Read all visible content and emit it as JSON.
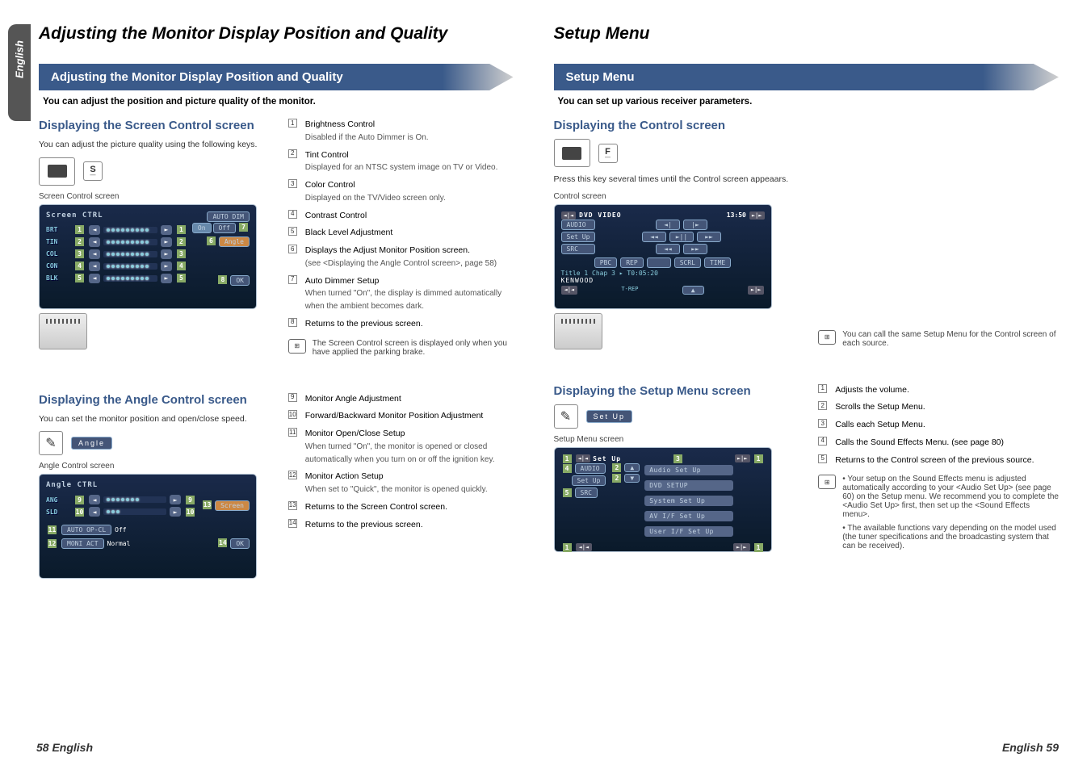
{
  "left": {
    "main_title": "Adjusting the Monitor Display Position and Quality",
    "side_tab": "English",
    "banner": "Adjusting the Monitor Display Position and Quality",
    "subtitle": "You can adjust the position and picture quality of the monitor.",
    "section1": {
      "heading": "Displaying the Screen Control screen",
      "body": "You can adjust the picture quality using the following keys.",
      "key_letter": "S",
      "screenshot_label": "Screen Control screen",
      "screen_title": "Screen CTRL",
      "auto_dim_label": "AUTO DIM",
      "on_label": "On",
      "off_label": "Off",
      "angle_btn": "Angle",
      "ok_btn": "OK",
      "sliders": [
        "BRT",
        "TIN",
        "COL",
        "CON",
        "BLK"
      ],
      "items": [
        {
          "n": "1",
          "title": "Brightness Control",
          "sub": "Disabled if the Auto Dimmer is On."
        },
        {
          "n": "2",
          "title": "Tint Control",
          "sub": "Displayed for an NTSC system image on TV or Video."
        },
        {
          "n": "3",
          "title": "Color Control",
          "sub": "Displayed on the TV/Video screen only."
        },
        {
          "n": "4",
          "title": "Contrast Control",
          "sub": ""
        },
        {
          "n": "5",
          "title": "Black Level Adjustment",
          "sub": ""
        },
        {
          "n": "6",
          "title": "Displays the Adjust Monitor Position screen.",
          "sub": "(see <Displaying the Angle Control screen>, page 58)"
        },
        {
          "n": "7",
          "title": "Auto Dimmer Setup",
          "sub": "When turned \"On\", the display is dimmed automatically when the ambient becomes dark."
        },
        {
          "n": "8",
          "title": "Returns to the previous screen.",
          "sub": ""
        }
      ],
      "note": "The Screen Control screen is displayed only when you have applied the parking brake."
    },
    "section2": {
      "heading": "Displaying the Angle Control screen",
      "body": "You can set the monitor position and open/close speed.",
      "angle_btn_label": "Angle",
      "screenshot_label": "Angle Control screen",
      "screen_title": "Angle CTRL",
      "ang_label": "ANG",
      "sld_label": "SLD",
      "auto_opcl_label": "AUTO OP-CL",
      "auto_opcl_value": "Off",
      "moni_act_label": "MONI ACT",
      "moni_act_value": "Normal",
      "screen_btn": "Screen",
      "ok_btn": "OK",
      "items": [
        {
          "n": "9",
          "title": "Monitor Angle Adjustment",
          "sub": ""
        },
        {
          "n": "10",
          "title": "Forward/Backward Monitor Position Adjustment",
          "sub": ""
        },
        {
          "n": "11",
          "title": "Monitor Open/Close Setup",
          "sub": "When turned \"On\", the monitor is opened or closed automatically when you turn on or off the ignition key."
        },
        {
          "n": "12",
          "title": "Monitor Action Setup",
          "sub": "When set to \"Quick\", the monitor is opened quickly."
        },
        {
          "n": "13",
          "title": "Returns to the Screen Control screen.",
          "sub": ""
        },
        {
          "n": "14",
          "title": "Returns to the previous screen.",
          "sub": ""
        }
      ]
    },
    "footer": "58 English"
  },
  "right": {
    "main_title": "Setup Menu",
    "banner": "Setup Menu",
    "subtitle": "You can set up various receiver parameters.",
    "section1": {
      "heading": "Displaying the Control screen",
      "key_letter": "F",
      "body": "Press this key several times until the Control screen appeaars.",
      "screenshot_label": "Control screen",
      "screen": {
        "title": "DVD VIDEO",
        "time": "13:50",
        "btns": [
          "AUDIO",
          "Set Up",
          "SRC"
        ],
        "lower_btns": [
          "PBC",
          "REP",
          "SCRL",
          "TIME"
        ],
        "status": "Title 1   Chap   3   ▸   T0:05:20",
        "brand": "KENWOOD",
        "trep": "T-REP"
      },
      "note": "You can call the same Setup Menu for the Control screen of each source."
    },
    "section2": {
      "heading": "Displaying the Setup Menu screen",
      "setup_btn": "Set Up",
      "screenshot_label": "Setup Menu screen",
      "screen": {
        "title": "Set Up",
        "side_btns": [
          "AUDIO",
          "Set Up",
          "SRC"
        ],
        "menu": [
          "Audio Set Up",
          "DVD SETUP",
          "System Set Up",
          "AV I/F Set Up",
          "User I/F Set Up"
        ]
      },
      "items": [
        {
          "n": "1",
          "title": "Adjusts the volume."
        },
        {
          "n": "2",
          "title": "Scrolls the Setup Menu."
        },
        {
          "n": "3",
          "title": "Calls each Setup Menu."
        },
        {
          "n": "4",
          "title": "Calls the Sound Effects Menu. (see page 80)"
        },
        {
          "n": "5",
          "title": "Returns to the Control screen of the previous source."
        }
      ],
      "notes": [
        "Your setup on the Sound Effects menu is adjusted automatically according to your <Audio Set Up> (see page 60) on the Setup menu. We recommend you to complete the <Audio Set Up> first, then set up the <Sound Effects menu>.",
        "The available functions vary depending on the model used (the tuner specifications and the broadcasting system that can be received)."
      ]
    },
    "footer": "English 59"
  }
}
